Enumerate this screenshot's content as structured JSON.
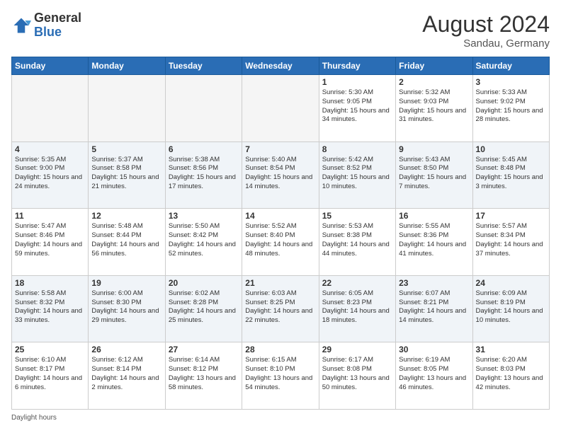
{
  "header": {
    "logo_general": "General",
    "logo_blue": "Blue",
    "month_year": "August 2024",
    "location": "Sandau, Germany"
  },
  "weekdays": [
    "Sunday",
    "Monday",
    "Tuesday",
    "Wednesday",
    "Thursday",
    "Friday",
    "Saturday"
  ],
  "footer": {
    "daylight_hours": "Daylight hours"
  },
  "weeks": [
    [
      {
        "day": "",
        "empty": true
      },
      {
        "day": "",
        "empty": true
      },
      {
        "day": "",
        "empty": true
      },
      {
        "day": "",
        "empty": true
      },
      {
        "day": "1",
        "sunrise": "Sunrise: 5:30 AM",
        "sunset": "Sunset: 9:05 PM",
        "daylight": "Daylight: 15 hours and 34 minutes."
      },
      {
        "day": "2",
        "sunrise": "Sunrise: 5:32 AM",
        "sunset": "Sunset: 9:03 PM",
        "daylight": "Daylight: 15 hours and 31 minutes."
      },
      {
        "day": "3",
        "sunrise": "Sunrise: 5:33 AM",
        "sunset": "Sunset: 9:02 PM",
        "daylight": "Daylight: 15 hours and 28 minutes."
      }
    ],
    [
      {
        "day": "4",
        "sunrise": "Sunrise: 5:35 AM",
        "sunset": "Sunset: 9:00 PM",
        "daylight": "Daylight: 15 hours and 24 minutes."
      },
      {
        "day": "5",
        "sunrise": "Sunrise: 5:37 AM",
        "sunset": "Sunset: 8:58 PM",
        "daylight": "Daylight: 15 hours and 21 minutes."
      },
      {
        "day": "6",
        "sunrise": "Sunrise: 5:38 AM",
        "sunset": "Sunset: 8:56 PM",
        "daylight": "Daylight: 15 hours and 17 minutes."
      },
      {
        "day": "7",
        "sunrise": "Sunrise: 5:40 AM",
        "sunset": "Sunset: 8:54 PM",
        "daylight": "Daylight: 15 hours and 14 minutes."
      },
      {
        "day": "8",
        "sunrise": "Sunrise: 5:42 AM",
        "sunset": "Sunset: 8:52 PM",
        "daylight": "Daylight: 15 hours and 10 minutes."
      },
      {
        "day": "9",
        "sunrise": "Sunrise: 5:43 AM",
        "sunset": "Sunset: 8:50 PM",
        "daylight": "Daylight: 15 hours and 7 minutes."
      },
      {
        "day": "10",
        "sunrise": "Sunrise: 5:45 AM",
        "sunset": "Sunset: 8:48 PM",
        "daylight": "Daylight: 15 hours and 3 minutes."
      }
    ],
    [
      {
        "day": "11",
        "sunrise": "Sunrise: 5:47 AM",
        "sunset": "Sunset: 8:46 PM",
        "daylight": "Daylight: 14 hours and 59 minutes."
      },
      {
        "day": "12",
        "sunrise": "Sunrise: 5:48 AM",
        "sunset": "Sunset: 8:44 PM",
        "daylight": "Daylight: 14 hours and 56 minutes."
      },
      {
        "day": "13",
        "sunrise": "Sunrise: 5:50 AM",
        "sunset": "Sunset: 8:42 PM",
        "daylight": "Daylight: 14 hours and 52 minutes."
      },
      {
        "day": "14",
        "sunrise": "Sunrise: 5:52 AM",
        "sunset": "Sunset: 8:40 PM",
        "daylight": "Daylight: 14 hours and 48 minutes."
      },
      {
        "day": "15",
        "sunrise": "Sunrise: 5:53 AM",
        "sunset": "Sunset: 8:38 PM",
        "daylight": "Daylight: 14 hours and 44 minutes."
      },
      {
        "day": "16",
        "sunrise": "Sunrise: 5:55 AM",
        "sunset": "Sunset: 8:36 PM",
        "daylight": "Daylight: 14 hours and 41 minutes."
      },
      {
        "day": "17",
        "sunrise": "Sunrise: 5:57 AM",
        "sunset": "Sunset: 8:34 PM",
        "daylight": "Daylight: 14 hours and 37 minutes."
      }
    ],
    [
      {
        "day": "18",
        "sunrise": "Sunrise: 5:58 AM",
        "sunset": "Sunset: 8:32 PM",
        "daylight": "Daylight: 14 hours and 33 minutes."
      },
      {
        "day": "19",
        "sunrise": "Sunrise: 6:00 AM",
        "sunset": "Sunset: 8:30 PM",
        "daylight": "Daylight: 14 hours and 29 minutes."
      },
      {
        "day": "20",
        "sunrise": "Sunrise: 6:02 AM",
        "sunset": "Sunset: 8:28 PM",
        "daylight": "Daylight: 14 hours and 25 minutes."
      },
      {
        "day": "21",
        "sunrise": "Sunrise: 6:03 AM",
        "sunset": "Sunset: 8:25 PM",
        "daylight": "Daylight: 14 hours and 22 minutes."
      },
      {
        "day": "22",
        "sunrise": "Sunrise: 6:05 AM",
        "sunset": "Sunset: 8:23 PM",
        "daylight": "Daylight: 14 hours and 18 minutes."
      },
      {
        "day": "23",
        "sunrise": "Sunrise: 6:07 AM",
        "sunset": "Sunset: 8:21 PM",
        "daylight": "Daylight: 14 hours and 14 minutes."
      },
      {
        "day": "24",
        "sunrise": "Sunrise: 6:09 AM",
        "sunset": "Sunset: 8:19 PM",
        "daylight": "Daylight: 14 hours and 10 minutes."
      }
    ],
    [
      {
        "day": "25",
        "sunrise": "Sunrise: 6:10 AM",
        "sunset": "Sunset: 8:17 PM",
        "daylight": "Daylight: 14 hours and 6 minutes."
      },
      {
        "day": "26",
        "sunrise": "Sunrise: 6:12 AM",
        "sunset": "Sunset: 8:14 PM",
        "daylight": "Daylight: 14 hours and 2 minutes."
      },
      {
        "day": "27",
        "sunrise": "Sunrise: 6:14 AM",
        "sunset": "Sunset: 8:12 PM",
        "daylight": "Daylight: 13 hours and 58 minutes."
      },
      {
        "day": "28",
        "sunrise": "Sunrise: 6:15 AM",
        "sunset": "Sunset: 8:10 PM",
        "daylight": "Daylight: 13 hours and 54 minutes."
      },
      {
        "day": "29",
        "sunrise": "Sunrise: 6:17 AM",
        "sunset": "Sunset: 8:08 PM",
        "daylight": "Daylight: 13 hours and 50 minutes."
      },
      {
        "day": "30",
        "sunrise": "Sunrise: 6:19 AM",
        "sunset": "Sunset: 8:05 PM",
        "daylight": "Daylight: 13 hours and 46 minutes."
      },
      {
        "day": "31",
        "sunrise": "Sunrise: 6:20 AM",
        "sunset": "Sunset: 8:03 PM",
        "daylight": "Daylight: 13 hours and 42 minutes."
      }
    ]
  ]
}
